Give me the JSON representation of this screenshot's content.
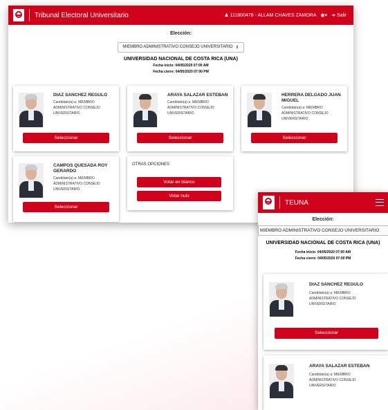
{
  "desktop": {
    "header": {
      "title": "Tribunal Electoral Universitario",
      "user": "111800478 - ALLAM CHAVES ZAMORA",
      "logout": "Salir"
    },
    "election_label": "Elección:",
    "election_value": "MIEMBRO ADMINISTRATIVO CONSEJO UNIVERSITARIO",
    "university": "UNIVERSIDAD NACIONAL DE COSTA RICA (UNA)",
    "start_date": "Fecha inicio: 04/05/2020 07:00 AM",
    "end_date": "Fecha cierre: 04/05/2020 07:00 PM",
    "candidates": [
      {
        "name": "DIAZ SANCHEZ REGULO",
        "role": "Candidato(a) a: MIEMBRO ADMINISTRATIVO CONSEJO UNIVERSITARIO",
        "button": "Seleccionar"
      },
      {
        "name": "ARAYA SALAZAR ESTEBAN",
        "role": "Candidato(a) a: MIEMBRO ADMINISTRATIVO CONSEJO UNIVERSITARIO",
        "button": "Seleccionar"
      },
      {
        "name": "HERRERA DELGADO JUAN MIGUEL",
        "role": "Candidato(a) a: MIEMBRO ADMINISTRATIVO CONSEJO UNIVERSITARIO",
        "button": "Seleccionar"
      },
      {
        "name": "CAMPOS QUESADA ROY GERARDO",
        "role": "Candidato(a) a: MIEMBRO ADMINISTRATIVO CONSEJO UNIVERSITARIO",
        "button": "Seleccionar"
      }
    ],
    "other_options": {
      "title": "OTRAS OPCIONES",
      "blank": "Votar en blanco",
      "null": "Votar nulo"
    }
  },
  "mobile": {
    "header": {
      "title": "TEUNA"
    },
    "election_label": "Elección:",
    "election_value": "MIEMBRO ADMINISTRATIVO CONSEJO UNIVERSITARIO",
    "university": "UNIVERSIDAD NACIONAL DE COSTA RICA (UNA)",
    "start_date": "Fecha inicio: 04/05/2020 07:00 AM",
    "end_date": "Fecha cierre: 04/05/2020 07:00 PM",
    "candidates": [
      {
        "name": "DIAZ SANCHEZ REGULO",
        "role": "Candidato(a) a: MIEMBRO ADMINISTRATIVO CONSEJO UNIVERSITARIO",
        "button": "Seleccionar"
      },
      {
        "name": "ARAYA SALAZAR ESTEBAN",
        "role": "Candidato(a) a: MIEMBRO ADMINISTRATIVO CONSEJO UNIVERSITARIO"
      }
    ]
  },
  "colors": {
    "brand": "#d0021b"
  }
}
